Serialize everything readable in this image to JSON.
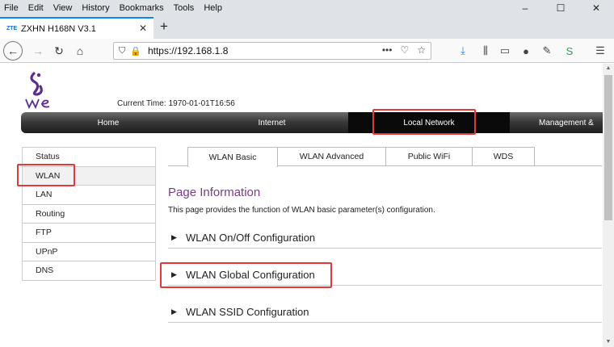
{
  "menubar": {
    "items": [
      "File",
      "Edit",
      "View",
      "History",
      "Bookmarks",
      "Tools",
      "Help"
    ]
  },
  "window": {
    "minimize": "–",
    "maximize": "☐",
    "close": "✕"
  },
  "tab": {
    "favicon": "ZTE",
    "title": "ZXHN H168N V3.1",
    "close": "✕",
    "newtab": "+"
  },
  "nav": {
    "url": "https://192.168.1.8"
  },
  "header": {
    "current_time_label": "Current Time:",
    "current_time_value": "1970-01-01T16:56"
  },
  "mainnav": {
    "items": [
      "Home",
      "Internet",
      "Local Network",
      "Management &"
    ]
  },
  "sidebar": {
    "items": [
      "Status",
      "WLAN",
      "LAN",
      "Routing",
      "FTP",
      "UPnP",
      "DNS"
    ]
  },
  "subtabs": {
    "items": [
      "WLAN Basic",
      "WLAN Advanced",
      "Public WiFi",
      "WDS"
    ]
  },
  "content": {
    "title": "Page Information",
    "description": "This page provides the function of WLAN basic parameter(s) configuration.",
    "sections": [
      "WLAN On/Off Configuration",
      "WLAN Global Configuration",
      "WLAN SSID Configuration"
    ]
  },
  "colors": {
    "accent_purple": "#7b3a8c",
    "highlight_red": "#e53935",
    "tab_blue": "#0a84ff"
  }
}
